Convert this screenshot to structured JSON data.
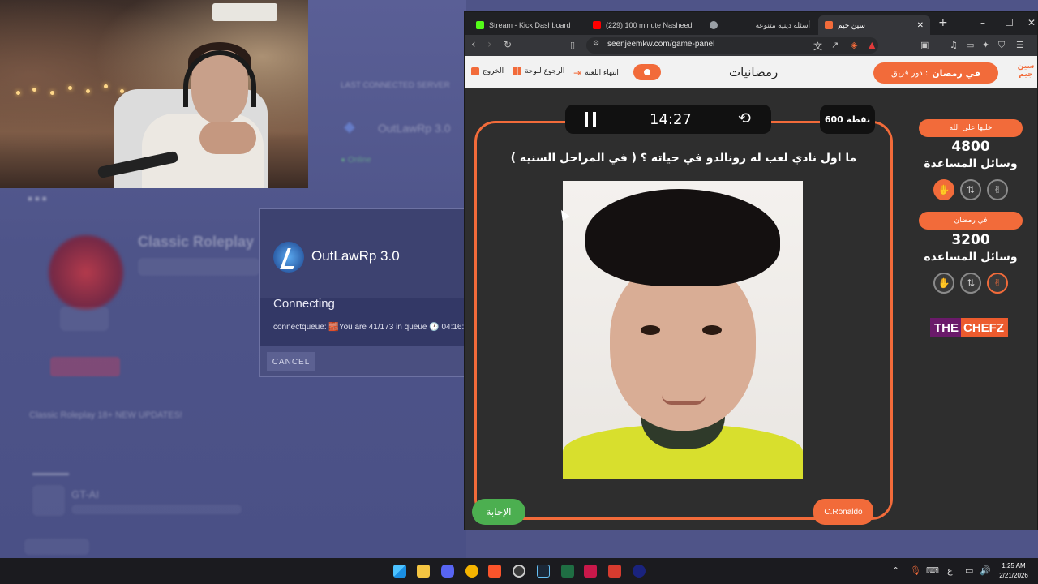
{
  "launcher_bg": {
    "server_name": "OutLawRp 3.0",
    "featured_title": "Classic Roleplay",
    "featured_sub": "Classic Roleplay 18+ NEW UPDATES!",
    "list_item_title": "GT-AI"
  },
  "dialog": {
    "title": "OutLawRp 3.0",
    "status": "Connecting",
    "queue_text": "connectqueue: 🧱You are 41/173 in queue 🕐 04:16:2",
    "cancel_label": "CANCEL"
  },
  "browser": {
    "tabs": [
      {
        "label": "Stream - Kick Dashboard",
        "color": "#53fc18",
        "active": false
      },
      {
        "label": "(229) 100 minute Nasheed",
        "color": "#ff0000",
        "active": false
      },
      {
        "label": "أسئلة دينية متنوعة",
        "color": "#9aa0a6",
        "active": false
      },
      {
        "label": "سين جيم",
        "color": "#f26b3a",
        "active": true
      }
    ],
    "new_tab_label": "+",
    "url": "seenjeemkw.com/game-panel",
    "window_controls": {
      "minimize": "–",
      "maximize": "☐",
      "close": "✕"
    }
  },
  "game": {
    "header": {
      "exit_label": "الخروج",
      "back_board_label": "الرجوع للوحة",
      "end_game_label": "انتهاء اللعبة",
      "category_title": "رمضانيات",
      "turn_prefix": "دور فريق :",
      "turn_team": "في رمضان",
      "logo_text": "سين جيم"
    },
    "timer": "14:27",
    "points_label": "600 نقطة",
    "question": "ما اول نادي لعب له رونالدو في حياته ؟ ( في المراحل السنيه )",
    "answer_button": "الإجابة",
    "answer_reveal": "C.Ronaldo",
    "teams": [
      {
        "name": "خليها على الله",
        "score": "4800",
        "helps_label": "وسائل المساعدة",
        "help_states": [
          "used",
          "off",
          "off"
        ]
      },
      {
        "name": "في رمضان",
        "score": "3200",
        "helps_label": "وسائل المساعدة",
        "help_states": [
          "off",
          "off",
          "outline"
        ]
      }
    ],
    "sponsor": {
      "part1": "THE",
      "part2": "CHEFZ"
    }
  },
  "taskbar": {
    "time": "1:25 AM",
    "date": "2/21/2026",
    "lang": "ع"
  },
  "colors": {
    "accent": "#f26b3a",
    "answer_green": "#4caf50",
    "launcher_bg": "#4f5488"
  }
}
